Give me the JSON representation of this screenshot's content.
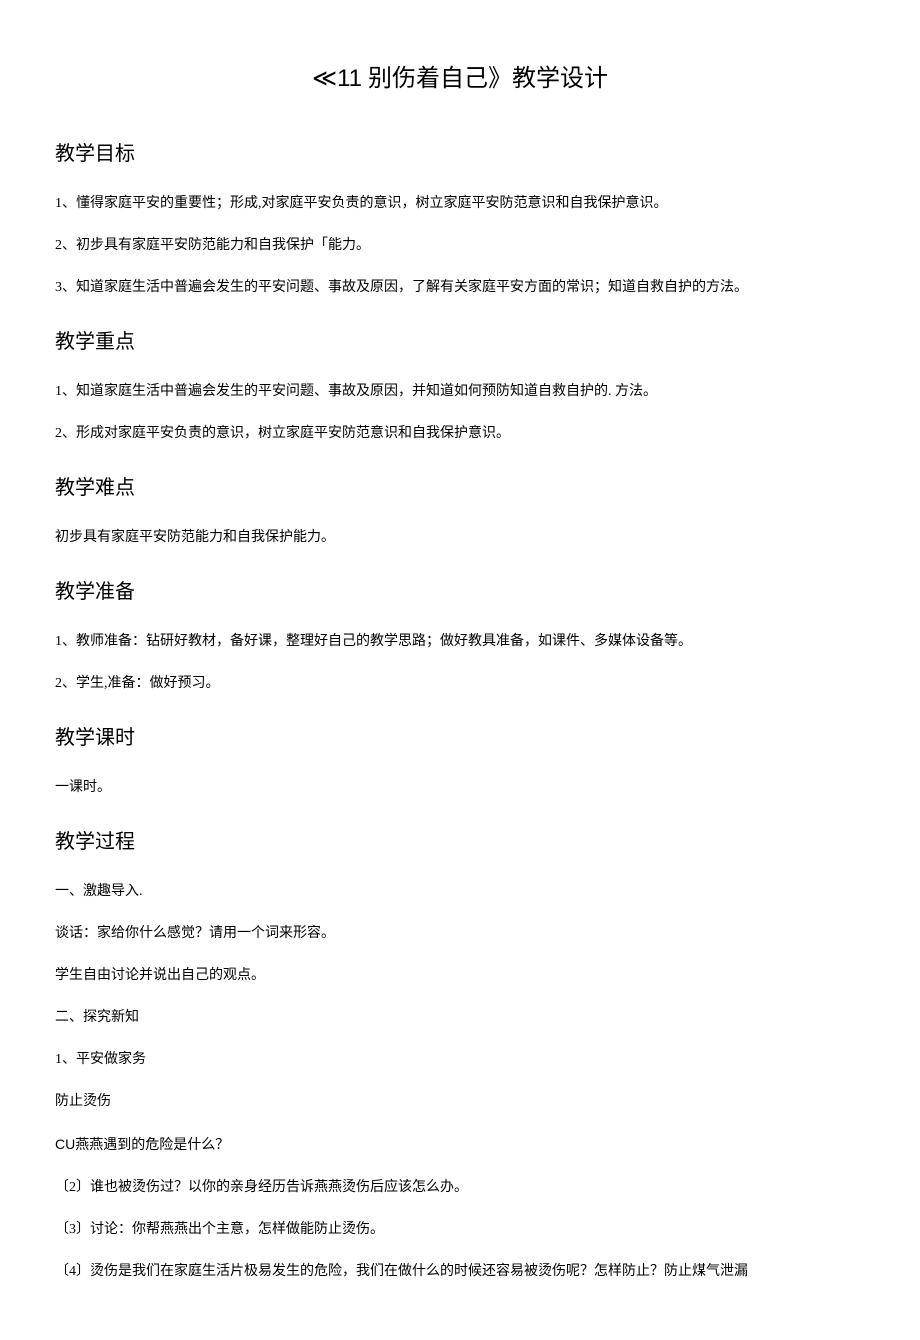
{
  "title": {
    "symbol": "≪11",
    "text": " 别伤着自己》教学设计"
  },
  "sections": {
    "goals": {
      "heading": "教学目标",
      "items": [
        "1、懂得家庭平安的重要性；形成,对家庭平安负责的意识，树立家庭平安防范意识和自我保护意识。",
        "2、初步具有家庭平安防范能力和自我保护「能力。",
        "3、知道家庭生活中普遍会发生的平安问题、事故及原因，了解有关家庭平安方面的常识；知道自救自护的方法。"
      ]
    },
    "keypoints": {
      "heading": "教学重点",
      "items": [
        "1、知道家庭生活中普遍会发生的平安问题、事故及原因，并知道如何预防知道自救自护的. 方法。",
        "2、形成对家庭平安负责的意识，树立家庭平安防范意识和自我保护意识。"
      ]
    },
    "difficulties": {
      "heading": "教学难点",
      "items": [
        "初步具有家庭平安防范能力和自我保护能力。"
      ]
    },
    "preparation": {
      "heading": "教学准备",
      "items": [
        "1、教师准备：钻研好教材，备好课，整理好自己的教学思路；做好教具准备，如课件、多媒体设备等。",
        "2、学生,准备：做好预习。"
      ]
    },
    "classtime": {
      "heading": "教学课时",
      "items": [
        "一课时。"
      ]
    },
    "process": {
      "heading": "教学过程",
      "items": [
        "一、激趣导入.",
        "谈话：家给你什么感觉？请用一个词来形容。",
        "学生自由讨论并说出自己的观点。",
        "二、探究新知",
        "1、平安做家务",
        "防止烫伤"
      ],
      "cu_prefix": "CU",
      "cu_text": "燕燕遇到的危险是什么？",
      "sub_items": [
        "〔2〕谁也被烫伤过？以你的亲身经历告诉燕燕烫伤后应该怎么办。",
        "〔3〕讨论：你帮燕燕出个主意，怎样做能防止烫伤。",
        "〔4〕烫伤是我们在家庭生活片极易发生的危险，我们在做什么的时候还容易被烫伤呢？怎样防止？防止煤气泄漏"
      ]
    }
  }
}
